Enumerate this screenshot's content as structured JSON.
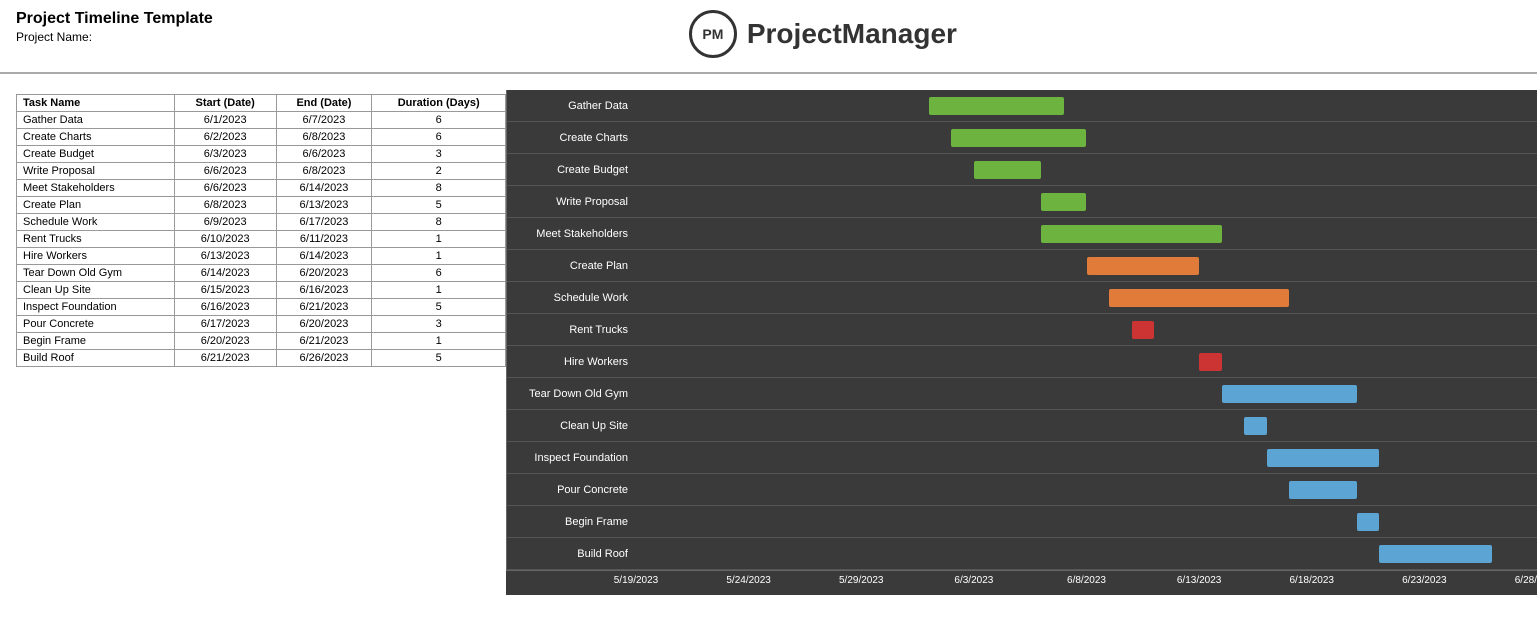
{
  "header": {
    "title": "Project Timeline Template",
    "project_name_label": "Project Name:"
  },
  "brand": {
    "initials": "PM",
    "name": "ProjectManager"
  },
  "table": {
    "columns": [
      "Task Name",
      "Start (Date)",
      "End  (Date)",
      "Duration (Days)"
    ],
    "rows": [
      {
        "task": "Gather Data",
        "start": "6/1/2023",
        "end": "6/7/2023",
        "duration": 6
      },
      {
        "task": "Create Charts",
        "start": "6/2/2023",
        "end": "6/8/2023",
        "duration": 6
      },
      {
        "task": "Create Budget",
        "start": "6/3/2023",
        "end": "6/6/2023",
        "duration": 3
      },
      {
        "task": "Write Proposal",
        "start": "6/6/2023",
        "end": "6/8/2023",
        "duration": 2
      },
      {
        "task": "Meet Stakeholders",
        "start": "6/6/2023",
        "end": "6/14/2023",
        "duration": 8
      },
      {
        "task": "Create Plan",
        "start": "6/8/2023",
        "end": "6/13/2023",
        "duration": 5
      },
      {
        "task": "Schedule Work",
        "start": "6/9/2023",
        "end": "6/17/2023",
        "duration": 8
      },
      {
        "task": "Rent Trucks",
        "start": "6/10/2023",
        "end": "6/11/2023",
        "duration": 1
      },
      {
        "task": "Hire Workers",
        "start": "6/13/2023",
        "end": "6/14/2023",
        "duration": 1
      },
      {
        "task": "Tear Down Old Gym",
        "start": "6/14/2023",
        "end": "6/20/2023",
        "duration": 6
      },
      {
        "task": "Clean Up Site",
        "start": "6/15/2023",
        "end": "6/16/2023",
        "duration": 1
      },
      {
        "task": "Inspect Foundation",
        "start": "6/16/2023",
        "end": "6/21/2023",
        "duration": 5
      },
      {
        "task": "Pour Concrete",
        "start": "6/17/2023",
        "end": "6/20/2023",
        "duration": 3
      },
      {
        "task": "Begin Frame",
        "start": "6/20/2023",
        "end": "6/21/2023",
        "duration": 1
      },
      {
        "task": "Build Roof",
        "start": "6/21/2023",
        "end": "6/26/2023",
        "duration": 5
      }
    ]
  },
  "gantt": {
    "x_labels": [
      "5/19/2023",
      "5/24/2023",
      "5/29/2023",
      "6/3/2023",
      "6/8/2023",
      "6/13/2023",
      "6/18/2023",
      "6/23/2023",
      "6/28/2023"
    ],
    "chart_start": "2023-05-19",
    "chart_end": "2023-06-28",
    "rows": [
      {
        "label": "Gather Data",
        "start": "2023-06-01",
        "end": "2023-06-07",
        "color": "#6db33f"
      },
      {
        "label": "Create Charts",
        "start": "2023-06-02",
        "end": "2023-06-08",
        "color": "#6db33f"
      },
      {
        "label": "Create Budget",
        "start": "2023-06-03",
        "end": "2023-06-06",
        "color": "#6db33f"
      },
      {
        "label": "Write Proposal",
        "start": "2023-06-06",
        "end": "2023-06-08",
        "color": "#6db33f"
      },
      {
        "label": "Meet Stakeholders",
        "start": "2023-06-06",
        "end": "2023-06-14",
        "color": "#6db33f"
      },
      {
        "label": "Create Plan",
        "start": "2023-06-08",
        "end": "2023-06-13",
        "color": "#e07b39"
      },
      {
        "label": "Schedule Work",
        "start": "2023-06-09",
        "end": "2023-06-17",
        "color": "#e07b39"
      },
      {
        "label": "Rent Trucks",
        "start": "2023-06-10",
        "end": "2023-06-11",
        "color": "#cc3333"
      },
      {
        "label": "Hire Workers",
        "start": "2023-06-13",
        "end": "2023-06-14",
        "color": "#cc3333"
      },
      {
        "label": "Tear Down Old Gym",
        "start": "2023-06-14",
        "end": "2023-06-20",
        "color": "#5ba4d4"
      },
      {
        "label": "Clean Up Site",
        "start": "2023-06-15",
        "end": "2023-06-16",
        "color": "#5ba4d4"
      },
      {
        "label": "Inspect Foundation",
        "start": "2023-06-16",
        "end": "2023-06-21",
        "color": "#5ba4d4"
      },
      {
        "label": "Pour Concrete",
        "start": "2023-06-17",
        "end": "2023-06-20",
        "color": "#5ba4d4"
      },
      {
        "label": "Begin Frame",
        "start": "2023-06-20",
        "end": "2023-06-21",
        "color": "#5ba4d4"
      },
      {
        "label": "Build Roof",
        "start": "2023-06-21",
        "end": "2023-06-26",
        "color": "#5ba4d4"
      }
    ]
  }
}
